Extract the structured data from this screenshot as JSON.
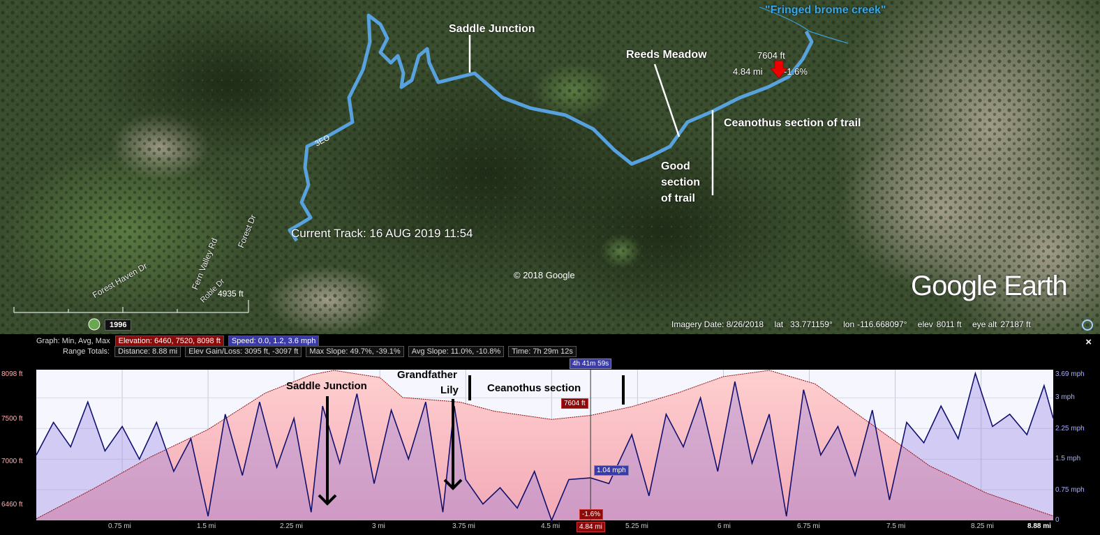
{
  "map": {
    "labels": {
      "fringed_brome_creek": "\"Fringed brome creek\"",
      "saddle_junction": "Saddle Junction",
      "reeds_meadow": "Reeds Meadow",
      "ceanothus_trail": "Ceanothus section of trail",
      "good_section_1": "Good",
      "good_section_2": "section",
      "good_section_3": "of trail",
      "marker_elev": "7604 ft",
      "marker_dist": "4.84 mi",
      "marker_slope": "-1.6%",
      "current_track": "Current Track: 16 AUG 2019 11:54",
      "track_num": "3EO",
      "copyright": "© 2018 Google",
      "logo": "Google Earth"
    },
    "roads": {
      "forest_haven": "Forest Haven Dr",
      "fern_valley": "Fern Valley Rd",
      "forest_dr": "Forest Dr",
      "roble": "Roble Dr"
    },
    "scale_label": "4935 ft",
    "year": "1996",
    "status": {
      "imagery": "Imagery Date: 8/26/2018",
      "lat_label": "lat",
      "lat": "33.771159°",
      "lon_label": "lon",
      "lon": "-116.668097°",
      "elev_label": "elev",
      "elev": "8011 ft",
      "eye_label": "eye alt",
      "eye": "27187 ft"
    }
  },
  "panel": {
    "graph_label": "Graph: Min, Avg, Max",
    "elevation_box": "Elevation: 6460, 7520, 8098 ft",
    "speed_box": "Speed: 0.0, 1.2, 3.6 mph",
    "range_label": "Range Totals:",
    "distance": "Distance: 8.88 mi",
    "elev_gain": "Elev Gain/Loss: 3095 ft, -3097 ft",
    "max_slope": "Max Slope: 49.7%, -39.1%",
    "avg_slope": "Avg Slope: 11.0%, -10.8%",
    "time": "Time: 7h 29m 12s",
    "close": "×"
  },
  "chart_data": {
    "type": "line",
    "x_unit": "mi",
    "xlim": [
      0,
      8.88
    ],
    "x_ticks": [
      "0.75 mi",
      "1.5 mi",
      "2.25 mi",
      "3 mi",
      "3.75 mi",
      "4.5 mi",
      "5.25 mi",
      "6 mi",
      "6.75 mi",
      "7.5 mi",
      "8.25 mi",
      "8.88 mi"
    ],
    "y_left_ticks": [
      "8098 ft",
      "7500 ft",
      "7000 ft",
      "6460 ft"
    ],
    "y_right_ticks": [
      "3.69 mph",
      "3 mph",
      "2.25 mph",
      "1.5 mph",
      "0.75 mph",
      "0"
    ],
    "ylim_left": [
      6460,
      8098
    ],
    "ylim_right": [
      0,
      3.69
    ],
    "elevation_series": {
      "x": [
        0,
        0.5,
        1,
        1.5,
        2,
        2.4,
        2.6,
        3,
        3.2,
        3.7,
        4.0,
        4.5,
        4.84,
        5.2,
        5.6,
        6.0,
        6.4,
        6.8,
        7.3,
        7.8,
        8.3,
        8.88
      ],
      "y": [
        6470,
        6800,
        7150,
        7450,
        7850,
        8050,
        8098,
        8020,
        7800,
        7750,
        7650,
        7560,
        7604,
        7700,
        7850,
        8030,
        8098,
        7950,
        7500,
        7050,
        6750,
        6500
      ]
    },
    "speed_series": {
      "x": [
        0,
        0.15,
        0.3,
        0.45,
        0.6,
        0.75,
        0.9,
        1.05,
        1.2,
        1.35,
        1.5,
        1.65,
        1.8,
        1.95,
        2.1,
        2.25,
        2.4,
        2.5,
        2.65,
        2.8,
        2.95,
        3.1,
        3.25,
        3.4,
        3.55,
        3.65,
        3.75,
        3.9,
        4.05,
        4.2,
        4.35,
        4.5,
        4.65,
        4.84,
        5.0,
        5.2,
        5.35,
        5.5,
        5.65,
        5.8,
        5.95,
        6.1,
        6.25,
        6.4,
        6.55,
        6.7,
        6.85,
        7.0,
        7.15,
        7.3,
        7.45,
        7.6,
        7.75,
        7.9,
        8.05,
        8.2,
        8.35,
        8.5,
        8.65,
        8.8,
        8.88
      ],
      "y": [
        1.6,
        2.4,
        1.8,
        2.9,
        1.7,
        2.3,
        1.5,
        2.4,
        1.2,
        2.0,
        0.1,
        2.6,
        1.1,
        2.9,
        1.3,
        2.5,
        0.2,
        2.8,
        1.4,
        3.1,
        0.9,
        2.7,
        1.5,
        2.9,
        0.2,
        2.8,
        1.0,
        0.4,
        0.8,
        0.3,
        1.2,
        0.0,
        1.0,
        1.04,
        0.9,
        2.1,
        0.6,
        2.6,
        1.8,
        3.0,
        1.2,
        3.4,
        1.4,
        2.6,
        0.1,
        3.2,
        1.6,
        2.3,
        1.1,
        2.7,
        0.5,
        2.4,
        1.9,
        2.8,
        2.0,
        3.6,
        2.3,
        2.6,
        2.1,
        3.3,
        2.5
      ],
      "color": "#10106e"
    },
    "elevation_color": "#8b0b0b",
    "cursor": {
      "time": "4h 41m 59s",
      "elev_tag": "7604 ft",
      "speed_tag": "1.04 mph",
      "slope_tag": "-1.6%",
      "dist_tag": "4.84 mi",
      "x": 4.84
    },
    "annotations": {
      "saddle": "Saddle Junction",
      "grandfather1": "Grandfather",
      "grandfather2": "Lily",
      "ceanothus": "Ceanothus section"
    }
  }
}
